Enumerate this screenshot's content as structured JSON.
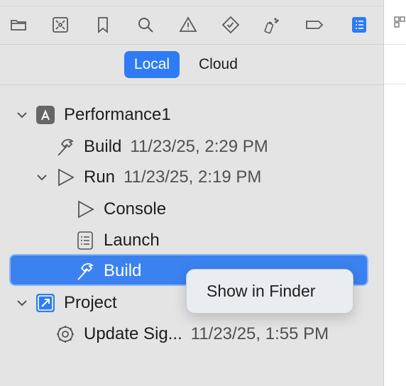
{
  "toolbar": {
    "icons": [
      "folder-icon",
      "target-icon",
      "bookmark-icon",
      "search-icon",
      "warning-icon",
      "diamond-check-icon",
      "spray-icon",
      "tag-icon",
      "report-list-icon"
    ],
    "accent": "#2f7bf5"
  },
  "segments": {
    "local": "Local",
    "cloud": "Cloud",
    "selected": "Local"
  },
  "tree": {
    "project_group": {
      "label": "Performance1"
    },
    "build_1": {
      "label": "Build",
      "time": "11/23/25, 2:29 PM"
    },
    "run": {
      "label": "Run",
      "time": "11/23/25, 2:19 PM"
    },
    "console": {
      "label": "Console"
    },
    "launch": {
      "label": "Launch"
    },
    "build_2": {
      "label": "Build"
    },
    "project": {
      "label": "Project"
    },
    "update": {
      "label": "Update Sig...",
      "time": "11/23/25, 1:55 PM"
    }
  },
  "context_menu": {
    "show_in_finder": "Show in Finder"
  },
  "colors": {
    "selection": "#3b82f0",
    "background": "#e4e4e4"
  }
}
